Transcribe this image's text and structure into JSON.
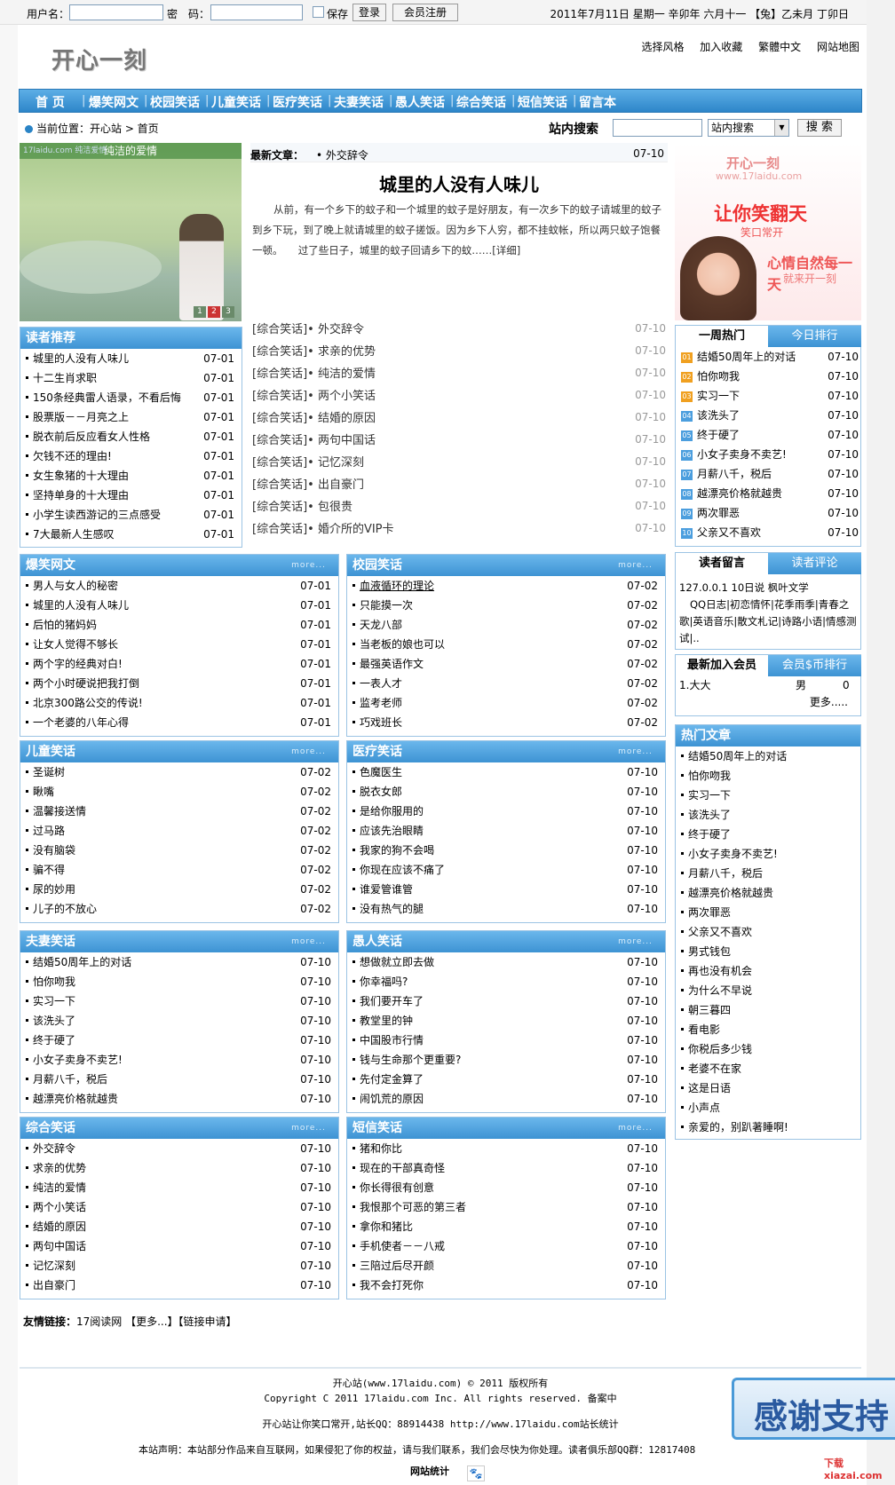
{
  "topbar": {
    "username_label": "用户名：",
    "password_label": "密　码：",
    "remember_label": "保存",
    "login_button": "登录",
    "register_button": "会员注册",
    "date_text": "2011年7月11日  星期一   辛卯年  六月十一 【兔】乙未月  丁卯日"
  },
  "header": {
    "logo_text": "开心一刻",
    "links": [
      "选择风格",
      "加入收藏",
      "繁體中文",
      "网站地图"
    ]
  },
  "nav": [
    "首 页",
    "爆笑网文",
    "校园笑话",
    "儿童笑话",
    "医疗笑话",
    "夫妻笑话",
    "愚人笑话",
    "综合笑话",
    "短信笑话",
    "留言本"
  ],
  "location": {
    "label": "当前位置：开心站 > 首页",
    "search_label": "站内搜索",
    "search_select": "站内搜索",
    "search_button": "搜 索"
  },
  "focus": {
    "caption": "纯洁的爱情",
    "caption_small": "17laidu.com  纯洁爱情",
    "pages": [
      "1",
      "2",
      "3"
    ]
  },
  "headline": {
    "latest_label": "最新文章：",
    "latest_title": "• 外交辞令",
    "latest_date": "07-10",
    "title": "城里的人没有人味儿",
    "body": "从前，有一个乡下的蚊子和一个城里的蚊子是好朋友，有一次乡下的蚊子请城里的蚊子到乡下玩，到了晚上就请城里的蚊子搓饭。因为乡下人穷，都不挂蚊帐，所以两只蚊子饱餐一顿。　　过了些日子，城里的蚊子回请乡下的蚊……[详细]"
  },
  "center_list": [
    {
      "cat": "[综合笑话]",
      "title": "• 外交辞令",
      "date": "07-10"
    },
    {
      "cat": "[综合笑话]",
      "title": "• 求亲的优势",
      "date": "07-10"
    },
    {
      "cat": "[综合笑话]",
      "title": "• 纯洁的爱情",
      "date": "07-10"
    },
    {
      "cat": "[综合笑话]",
      "title": "• 两个小笑话",
      "date": "07-10"
    },
    {
      "cat": "[综合笑话]",
      "title": "• 结婚的原因",
      "date": "07-10"
    },
    {
      "cat": "[综合笑话]",
      "title": "• 两句中国话",
      "date": "07-10"
    },
    {
      "cat": "[综合笑话]",
      "title": "• 记忆深刻",
      "date": "07-10"
    },
    {
      "cat": "[综合笑话]",
      "title": "• 出自豪门",
      "date": "07-10"
    },
    {
      "cat": "[综合笑话]",
      "title": "• 包很贵",
      "date": "07-10"
    },
    {
      "cat": "[综合笑话]",
      "title": "• 婚介所的VIP卡",
      "date": "07-10"
    }
  ],
  "ad": {
    "line1": "开心一刻",
    "line2": "www.17laidu.com",
    "line3": "让你笑翻天",
    "line4": "笑口常开",
    "line5": "心情自然每一天",
    "line6": "就来开一刻"
  },
  "reader_recommend": {
    "title": "读者推荐",
    "items": [
      {
        "t": "城里的人没有人味儿",
        "d": "07-01"
      },
      {
        "t": "十二生肖求职",
        "d": "07-01"
      },
      {
        "t": "150条经典雷人语录，不看后悔",
        "d": "07-01"
      },
      {
        "t": "股票版－－月亮之上",
        "d": "07-01"
      },
      {
        "t": "脱衣前后反应看女人性格",
        "d": "07-01"
      },
      {
        "t": "欠钱不还的理由!",
        "d": "07-01"
      },
      {
        "t": "女生象猪的十大理由",
        "d": "07-01"
      },
      {
        "t": "坚持单身的十大理由",
        "d": "07-01"
      },
      {
        "t": "小学生读西游记的三点感受",
        "d": "07-01"
      },
      {
        "t": "7大最新人生感叹",
        "d": "07-01"
      }
    ]
  },
  "weekly_hot": {
    "tab_on": "一周热门",
    "tab_off": "今日排行",
    "items": [
      {
        "n": "01",
        "t": "结婚50周年上的对话",
        "d": "07-10"
      },
      {
        "n": "02",
        "t": "怕你吻我",
        "d": "07-10"
      },
      {
        "n": "03",
        "t": "实习一下",
        "d": "07-10"
      },
      {
        "n": "04",
        "t": "该洗头了",
        "d": "07-10"
      },
      {
        "n": "05",
        "t": "终于硬了",
        "d": "07-10"
      },
      {
        "n": "06",
        "t": "小女子卖身不卖艺!",
        "d": "07-10"
      },
      {
        "n": "07",
        "t": "月薪八千，税后",
        "d": "07-10"
      },
      {
        "n": "08",
        "t": "越漂亮价格就越贵",
        "d": "07-10"
      },
      {
        "n": "09",
        "t": "两次罪恶",
        "d": "07-10"
      },
      {
        "n": "10",
        "t": "父亲又不喜欢",
        "d": "07-10"
      }
    ]
  },
  "guestbook": {
    "tab_on": "读者留言",
    "tab_off": "读者评论",
    "text": "127.0.0.1 10日说 枫叶文学",
    "text2": "QQ日志|初恋情怀|花季雨季|青春之歌|英语音乐|散文札记|诗路小语|情感测试|.."
  },
  "members": {
    "tab_on": "最新加入会员",
    "tab_off": "会员$币排行",
    "name": "1.大大",
    "gender": "男",
    "score": "0",
    "more": "更多....."
  },
  "hot_articles": {
    "title": "热门文章",
    "items": [
      "结婚50周年上的对话",
      "怕你吻我",
      "实习一下",
      "该洗头了",
      "终于硬了",
      "小女子卖身不卖艺!",
      "月薪八千，税后",
      "越漂亮价格就越贵",
      "两次罪恶",
      "父亲又不喜欢",
      "男式钱包",
      "再也没有机会",
      "为什么不早说",
      "朝三暮四",
      "看电影",
      "你税后多少钱",
      "老婆不在家",
      "这是日语",
      "小声点",
      "亲爱的，别趴著睡啊!"
    ]
  },
  "sections": [
    {
      "title": "爆笑网文",
      "more": "more...",
      "items": [
        {
          "t": "男人与女人的秘密",
          "d": "07-01"
        },
        {
          "t": "城里的人没有人味儿",
          "d": "07-01"
        },
        {
          "t": "后怕的猪妈妈",
          "d": "07-01"
        },
        {
          "t": "让女人觉得不够长",
          "d": "07-01"
        },
        {
          "t": "两个字的经典对白!",
          "d": "07-01"
        },
        {
          "t": "两个小时硬说把我打倒",
          "d": "07-01"
        },
        {
          "t": "北京300路公交的传说!",
          "d": "07-01"
        },
        {
          "t": "一个老婆的八年心得",
          "d": "07-01"
        }
      ]
    },
    {
      "title": "校园笑话",
      "more": "more...",
      "items": [
        {
          "t": "血液循环的理论",
          "d": "07-02"
        },
        {
          "t": "只能摸一次",
          "d": "07-02"
        },
        {
          "t": "天龙八部",
          "d": "07-02"
        },
        {
          "t": "当老板的娘也可以",
          "d": "07-02"
        },
        {
          "t": "最强英语作文",
          "d": "07-02"
        },
        {
          "t": "一表人才",
          "d": "07-02"
        },
        {
          "t": "监考老师",
          "d": "07-02"
        },
        {
          "t": "巧戏班长",
          "d": "07-02"
        }
      ]
    },
    {
      "title": "儿童笑话",
      "more": "more...",
      "items": [
        {
          "t": "圣诞树",
          "d": "07-02"
        },
        {
          "t": "瞅嘴",
          "d": "07-02"
        },
        {
          "t": "温馨接送情",
          "d": "07-02"
        },
        {
          "t": "过马路",
          "d": "07-02"
        },
        {
          "t": "没有脑袋",
          "d": "07-02"
        },
        {
          "t": "骗不得",
          "d": "07-02"
        },
        {
          "t": "尿的妙用",
          "d": "07-02"
        },
        {
          "t": "儿子的不放心",
          "d": "07-02"
        }
      ]
    },
    {
      "title": "医疗笑话",
      "more": "more...",
      "items": [
        {
          "t": "色魔医生",
          "d": "07-10"
        },
        {
          "t": "脱衣女郎",
          "d": "07-10"
        },
        {
          "t": "是给你服用的",
          "d": "07-10"
        },
        {
          "t": "应该先治眼睛",
          "d": "07-10"
        },
        {
          "t": "我家的狗不会喝",
          "d": "07-10"
        },
        {
          "t": "你现在应该不痛了",
          "d": "07-10"
        },
        {
          "t": "谁爱管谁管",
          "d": "07-10"
        },
        {
          "t": "没有热气的腿",
          "d": "07-10"
        }
      ]
    },
    {
      "title": "夫妻笑话",
      "more": "more...",
      "items": [
        {
          "t": "结婚50周年上的对话",
          "d": "07-10"
        },
        {
          "t": "怕你吻我",
          "d": "07-10"
        },
        {
          "t": "实习一下",
          "d": "07-10"
        },
        {
          "t": "该洗头了",
          "d": "07-10"
        },
        {
          "t": "终于硬了",
          "d": "07-10"
        },
        {
          "t": "小女子卖身不卖艺!",
          "d": "07-10"
        },
        {
          "t": "月薪八千，税后",
          "d": "07-10"
        },
        {
          "t": "越漂亮价格就越贵",
          "d": "07-10"
        }
      ]
    },
    {
      "title": "愚人笑话",
      "more": "more...",
      "items": [
        {
          "t": "想做就立即去做",
          "d": "07-10"
        },
        {
          "t": "你幸福吗?",
          "d": "07-10"
        },
        {
          "t": "我们要开车了",
          "d": "07-10"
        },
        {
          "t": "教堂里的钟",
          "d": "07-10"
        },
        {
          "t": "中国股市行情",
          "d": "07-10"
        },
        {
          "t": "钱与生命那个更重要?",
          "d": "07-10"
        },
        {
          "t": "先付定金算了",
          "d": "07-10"
        },
        {
          "t": "闹饥荒的原因",
          "d": "07-10"
        }
      ]
    },
    {
      "title": "综合笑话",
      "more": "more...",
      "items": [
        {
          "t": "外交辞令",
          "d": "07-10"
        },
        {
          "t": "求亲的优势",
          "d": "07-10"
        },
        {
          "t": "纯洁的爱情",
          "d": "07-10"
        },
        {
          "t": "两个小笑话",
          "d": "07-10"
        },
        {
          "t": "结婚的原因",
          "d": "07-10"
        },
        {
          "t": "两句中国话",
          "d": "07-10"
        },
        {
          "t": "记忆深刻",
          "d": "07-10"
        },
        {
          "t": "出自豪门",
          "d": "07-10"
        }
      ]
    },
    {
      "title": "短信笑话",
      "more": "more...",
      "items": [
        {
          "t": "猪和你比",
          "d": "07-10"
        },
        {
          "t": "现在的干部真奇怪",
          "d": "07-10"
        },
        {
          "t": "你长得很有创意",
          "d": "07-10"
        },
        {
          "t": "我恨那个可恶的第三者",
          "d": "07-10"
        },
        {
          "t": "拿你和猪比",
          "d": "07-10"
        },
        {
          "t": "手机使者－－八戒",
          "d": "07-10"
        },
        {
          "t": "三陪过后尽开颜",
          "d": "07-10"
        },
        {
          "t": "我不会打死你",
          "d": "07-10"
        }
      ]
    }
  ],
  "friend_links": {
    "label": "友情链接：",
    "text": "17阅读网 【更多...】【链接申请】"
  },
  "footer": {
    "line1": "开心站(www.17laidu.com) © 2011 版权所有",
    "line2": "Copyright C 2011 17laidu.com Inc. All rights reserved. 备案中",
    "line3": "开心站让你笑口常开,站长QQ：88914438 http://www.17laidu.com站长统计",
    "line4": "本站声明：本站部分作品来自互联网，如果侵犯了你的权益，请与我们联系，我们会尽快为你处理。读者俱乐部QQ群：12817408",
    "stats_label": "网站统计"
  },
  "thanks_banner": "感谢支持",
  "xz_logo": "下载 xiazai.com"
}
